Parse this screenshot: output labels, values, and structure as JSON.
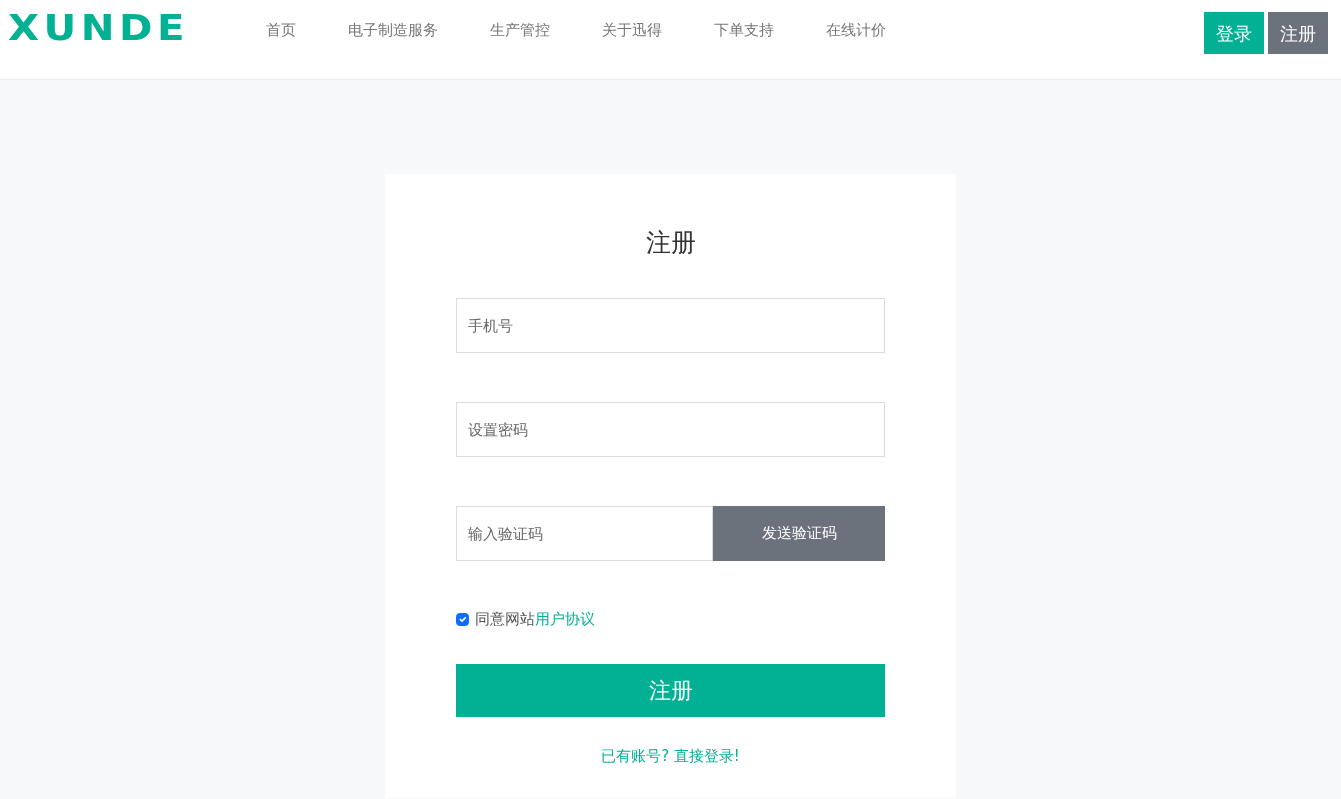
{
  "header": {
    "logo": "XUNDE",
    "nav": [
      {
        "label": "首页"
      },
      {
        "label": "电子制造服务"
      },
      {
        "label": "生产管控"
      },
      {
        "label": "关于迅得"
      },
      {
        "label": "下单支持"
      },
      {
        "label": "在线计价"
      }
    ],
    "buttons": [
      {
        "label": "登录",
        "kind": "primary"
      },
      {
        "label": "注册",
        "kind": "secondary"
      }
    ]
  },
  "form": {
    "title": "注册",
    "fields": [
      {
        "placeholder": "手机号",
        "kind": "text"
      },
      {
        "placeholder": "设置密码",
        "kind": "password"
      },
      {
        "placeholder": "输入验证码",
        "kind": "code",
        "button": "发送验证码"
      }
    ],
    "agreement": {
      "checked": true,
      "text": "同意网站",
      "link": "用户协议"
    },
    "submit": "注册",
    "login_link": "已有账号? 直接登录!"
  }
}
